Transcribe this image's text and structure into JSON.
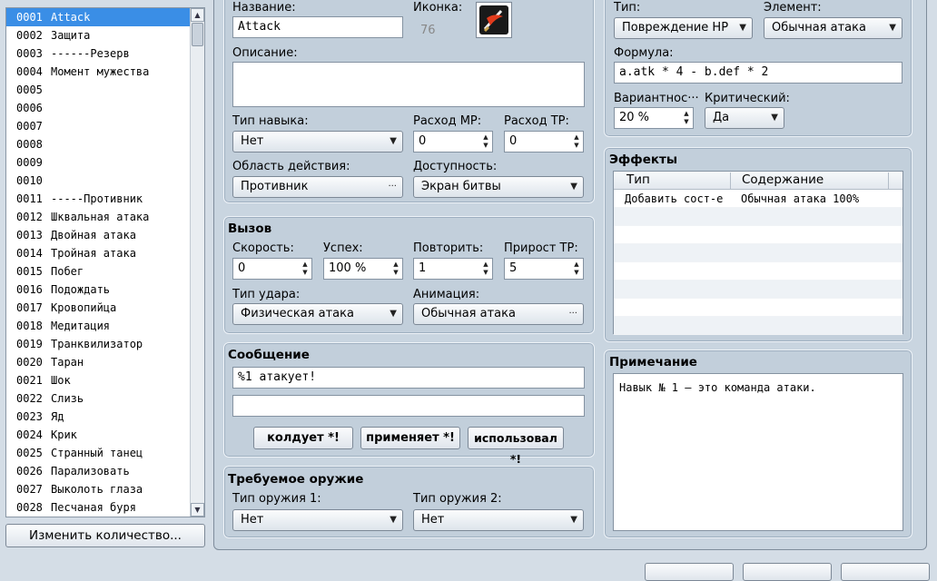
{
  "skill_list": [
    {
      "num": "0001",
      "name": "Attack",
      "selected": true
    },
    {
      "num": "0002",
      "name": "Защита"
    },
    {
      "num": "0003",
      "name": "------Резерв"
    },
    {
      "num": "0004",
      "name": "Момент мужества"
    },
    {
      "num": "0005",
      "name": ""
    },
    {
      "num": "0006",
      "name": ""
    },
    {
      "num": "0007",
      "name": ""
    },
    {
      "num": "0008",
      "name": ""
    },
    {
      "num": "0009",
      "name": ""
    },
    {
      "num": "0010",
      "name": ""
    },
    {
      "num": "0011",
      "name": "-----Противник"
    },
    {
      "num": "0012",
      "name": "Шквальная атака"
    },
    {
      "num": "0013",
      "name": "Двойная атака"
    },
    {
      "num": "0014",
      "name": "Тройная атака"
    },
    {
      "num": "0015",
      "name": "Побег"
    },
    {
      "num": "0016",
      "name": "Подождать"
    },
    {
      "num": "0017",
      "name": "Кровопийца"
    },
    {
      "num": "0018",
      "name": "Медитация"
    },
    {
      "num": "0019",
      "name": "Транквилизатор"
    },
    {
      "num": "0020",
      "name": "Таран"
    },
    {
      "num": "0021",
      "name": "Шок"
    },
    {
      "num": "0022",
      "name": "Слизь"
    },
    {
      "num": "0023",
      "name": "Яд"
    },
    {
      "num": "0024",
      "name": "Крик"
    },
    {
      "num": "0025",
      "name": "Странный танец"
    },
    {
      "num": "0026",
      "name": "Парализовать"
    },
    {
      "num": "0027",
      "name": "Выколоть глаза"
    },
    {
      "num": "0028",
      "name": "Песчаная буря"
    }
  ],
  "change_count_label": "Изменить количество...",
  "general": {
    "name_label": "Название:",
    "name_value": "Attack",
    "icon_label": "Иконка:",
    "icon_index": "76",
    "icon_name": "sword-slash-icon",
    "desc_label": "Описание:",
    "desc_value": "",
    "skill_type_label": "Тип навыка:",
    "skill_type_value": "Нет",
    "mp_cost_label": "Расход MP:",
    "mp_cost_value": "0",
    "tp_cost_label": "Расход TP:",
    "tp_cost_value": "0",
    "scope_label": "Область действия:",
    "scope_value": "Противник",
    "occasion_label": "Доступность:",
    "occasion_value": "Экран битвы"
  },
  "invocation": {
    "title": "Вызов",
    "speed_label": "Скорость:",
    "speed_value": "0",
    "success_label": "Успех:",
    "success_value": "100 %",
    "repeat_label": "Повторить:",
    "repeat_value": "1",
    "tp_gain_label": "Прирост TP:",
    "tp_gain_value": "5",
    "hit_type_label": "Тип удара:",
    "hit_type_value": "Физическая атака",
    "animation_label": "Анимация:",
    "animation_value": "Обычная атака"
  },
  "message": {
    "title": "Сообщение",
    "line1": "%1 атакует!",
    "line2": "",
    "btn_casts": "колдует *!",
    "btn_uses": "применяет *!",
    "btn_used": "использовал *!"
  },
  "required_weapon": {
    "title": "Требуемое оружие",
    "type1_label": "Тип оружия 1:",
    "type1_value": "Нет",
    "type2_label": "Тип оружия 2:",
    "type2_value": "Нет"
  },
  "damage": {
    "type_label": "Тип:",
    "type_value": "Повреждение HP",
    "element_label": "Элемент:",
    "element_value": "Обычная атака",
    "formula_label": "Формула:",
    "formula_value": "a.atk * 4 - b.def * 2",
    "variance_label": "Вариантнос···",
    "variance_value": "20 %",
    "critical_label": "Критический:",
    "critical_value": "Да"
  },
  "effects": {
    "title": "Эффекты",
    "col_type": "Тип",
    "col_content": "Содержание",
    "rows": [
      {
        "type": "Добавить сост-е",
        "content": "Обычная атака 100%"
      }
    ]
  },
  "note": {
    "title": "Примечание",
    "value": "Навык № 1 – это команда атаки."
  }
}
